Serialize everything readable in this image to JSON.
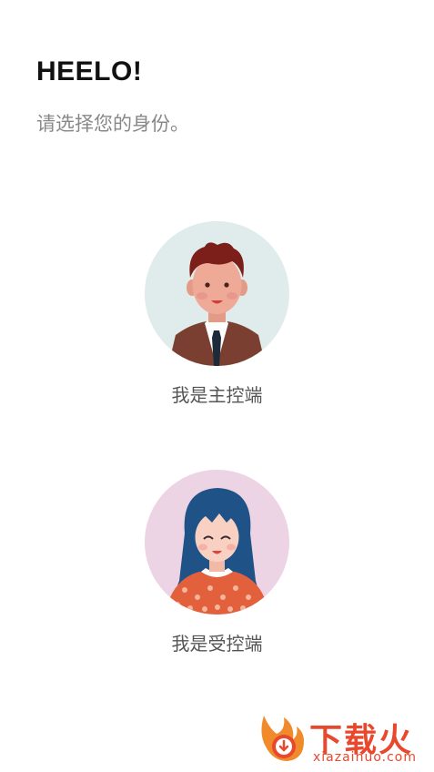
{
  "header": {
    "greeting": "HEELO!",
    "subtitle": "请选择您的身份。"
  },
  "roles": [
    {
      "label": "我是主控端",
      "avatar_bg": "#dfeceb",
      "icon": "male-avatar-icon"
    },
    {
      "label": "我是受控端",
      "avatar_bg": "#ecd4e4",
      "icon": "female-avatar-icon"
    }
  ],
  "watermark": {
    "brand": "下载火",
    "domain": "xiazaihuo.com",
    "color": "#e8492e"
  }
}
